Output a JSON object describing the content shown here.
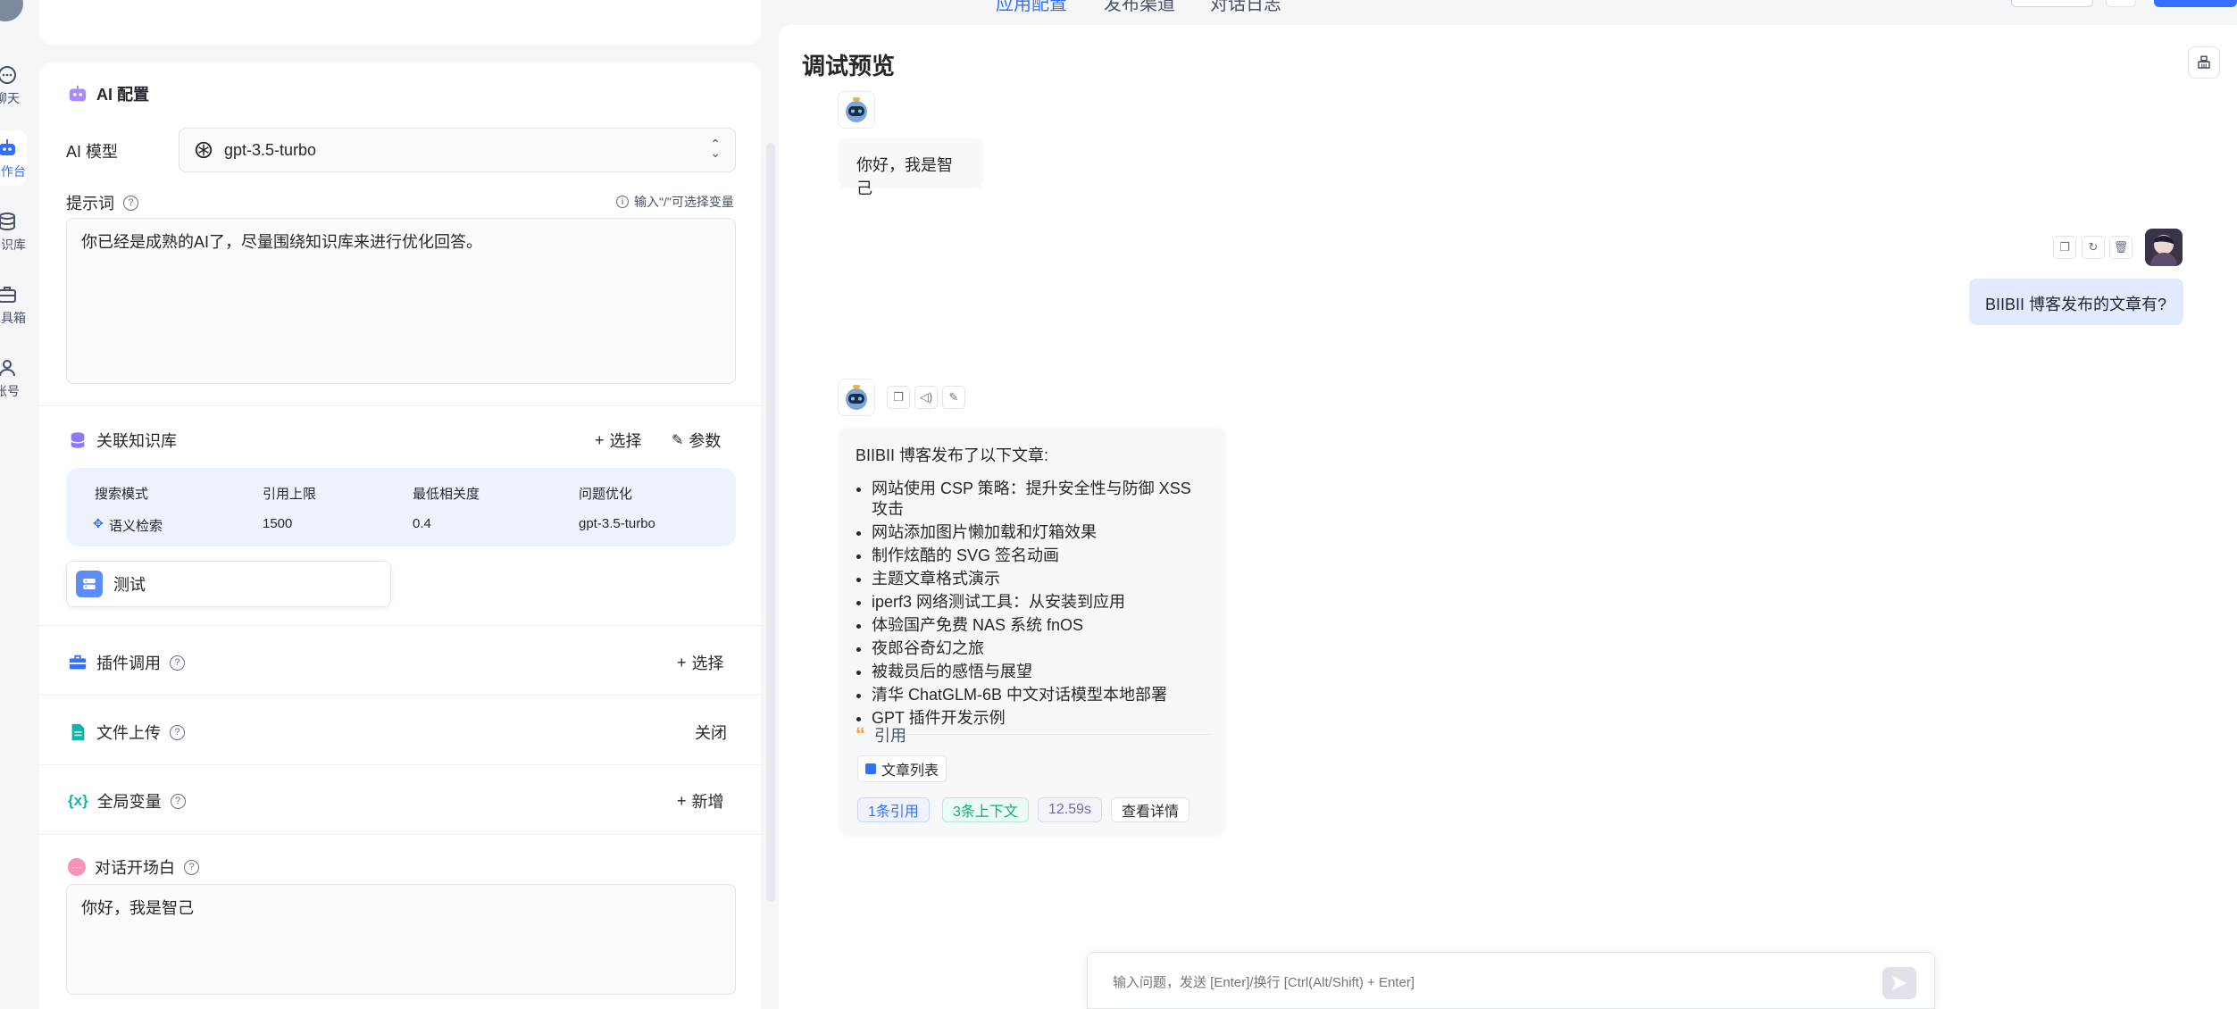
{
  "top_tabs": [
    {
      "label": "应用配置",
      "active": true
    },
    {
      "label": "发布渠道",
      "active": false
    },
    {
      "label": "对话日志",
      "active": false
    }
  ],
  "rail": [
    {
      "label": "聊天",
      "icon": "chat-icon"
    },
    {
      "label": "工作台",
      "icon": "robot-icon",
      "active": true
    },
    {
      "label": "知识库",
      "icon": "database-icon"
    },
    {
      "label": "工具箱",
      "icon": "toolbox-icon"
    },
    {
      "label": "账号",
      "icon": "user-icon"
    }
  ],
  "ai_config": {
    "title": "AI 配置",
    "model_label": "AI 模型",
    "model_value": "gpt-3.5-turbo",
    "prompt_label": "提示词",
    "prompt_hint": "输入\"/\"可选择变量",
    "prompt_value": "你已经是成熟的AI了，尽量围绕知识库来进行优化回答。"
  },
  "knowledge": {
    "title": "关联知识库",
    "select_label": "选择",
    "params_label": "参数",
    "headers": [
      "搜索模式",
      "引用上限",
      "最低相关度",
      "问题优化"
    ],
    "values": [
      "语义检索",
      "1500",
      "0.4",
      "gpt-3.5-turbo"
    ],
    "dataset_name": "测试"
  },
  "plugins": {
    "title": "插件调用",
    "action": "选择"
  },
  "file_upload": {
    "title": "文件上传",
    "value": "关闭"
  },
  "variables": {
    "title": "全局变量",
    "action": "新增"
  },
  "welcome": {
    "title": "对话开场白",
    "value": "你好，我是智己"
  },
  "chat": {
    "title": "调试预览",
    "greeting": "你好，我是智己",
    "user_message": "BIIBII 博客发布的文章有?",
    "answer_intro": "BIIBII 博客发布了以下文章:",
    "answer_items": [
      "网站使用 CSP 策略：提升安全性与防御 XSS 攻击",
      "网站添加图片懒加载和灯箱效果",
      "制作炫酷的 SVG 签名动画",
      "主题文章格式演示",
      "iperf3 网络测试工具：从安装到应用",
      "体验国产免费 NAS 系统 fnOS",
      "夜郎谷奇幻之旅",
      "被裁员后的感悟与展望",
      "清华 ChatGLM-6B 中文对话模型本地部署",
      "GPT 插件开发示例"
    ],
    "quote_label": "引用",
    "quote_source": "文章列表",
    "tags": {
      "refs": "1条引用",
      "context": "3条上下文",
      "time": "12.59s",
      "detail": "查看详情"
    },
    "input_placeholder": "输入问题，发送 [Enter]/换行 [Ctrl(Alt/Shift) + Enter]"
  },
  "colors": {
    "accent": "#3370ff",
    "user_bubble": "#e1eafe",
    "kb_table": "#edf2fd"
  }
}
